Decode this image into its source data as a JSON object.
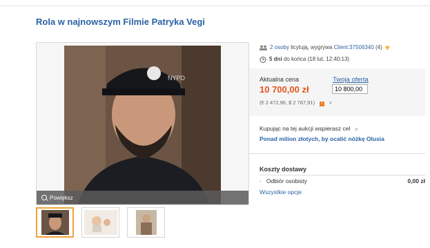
{
  "listing": {
    "title": "Rola w najnowszym Filmie Patryka Vegi"
  },
  "gallery": {
    "zoom_label": "Powiększ"
  },
  "bidding": {
    "bidders_count": "2 osoby",
    "bidders_text": " licytują, wygrywa ",
    "leader": "Client:37506340",
    "leader_rating": " (4)",
    "time_left": "5 dni",
    "time_suffix": " do końca (18 lut, 12:40:13)"
  },
  "price": {
    "label": "Aktualna cena",
    "value": "10 700,00 zł",
    "conversion": "(€ 2 472,96, $ 2 787,91)",
    "offer_label": "Twoja oferta",
    "offer_value": "10 800,00"
  },
  "charity": {
    "text": "Kupując na tej aukcji wspierasz cel",
    "cause": "Ponad milion złotych, by ocalić nóżkę Olusia"
  },
  "shipping": {
    "header": "Koszty dostawy",
    "method": "Odbiór osobisty",
    "cost": "0,00 zł",
    "all_options": "Wszystkie opcje"
  },
  "colors": {
    "link": "#2a62a6",
    "price": "#e5541e",
    "accent": "#f0a23a"
  }
}
